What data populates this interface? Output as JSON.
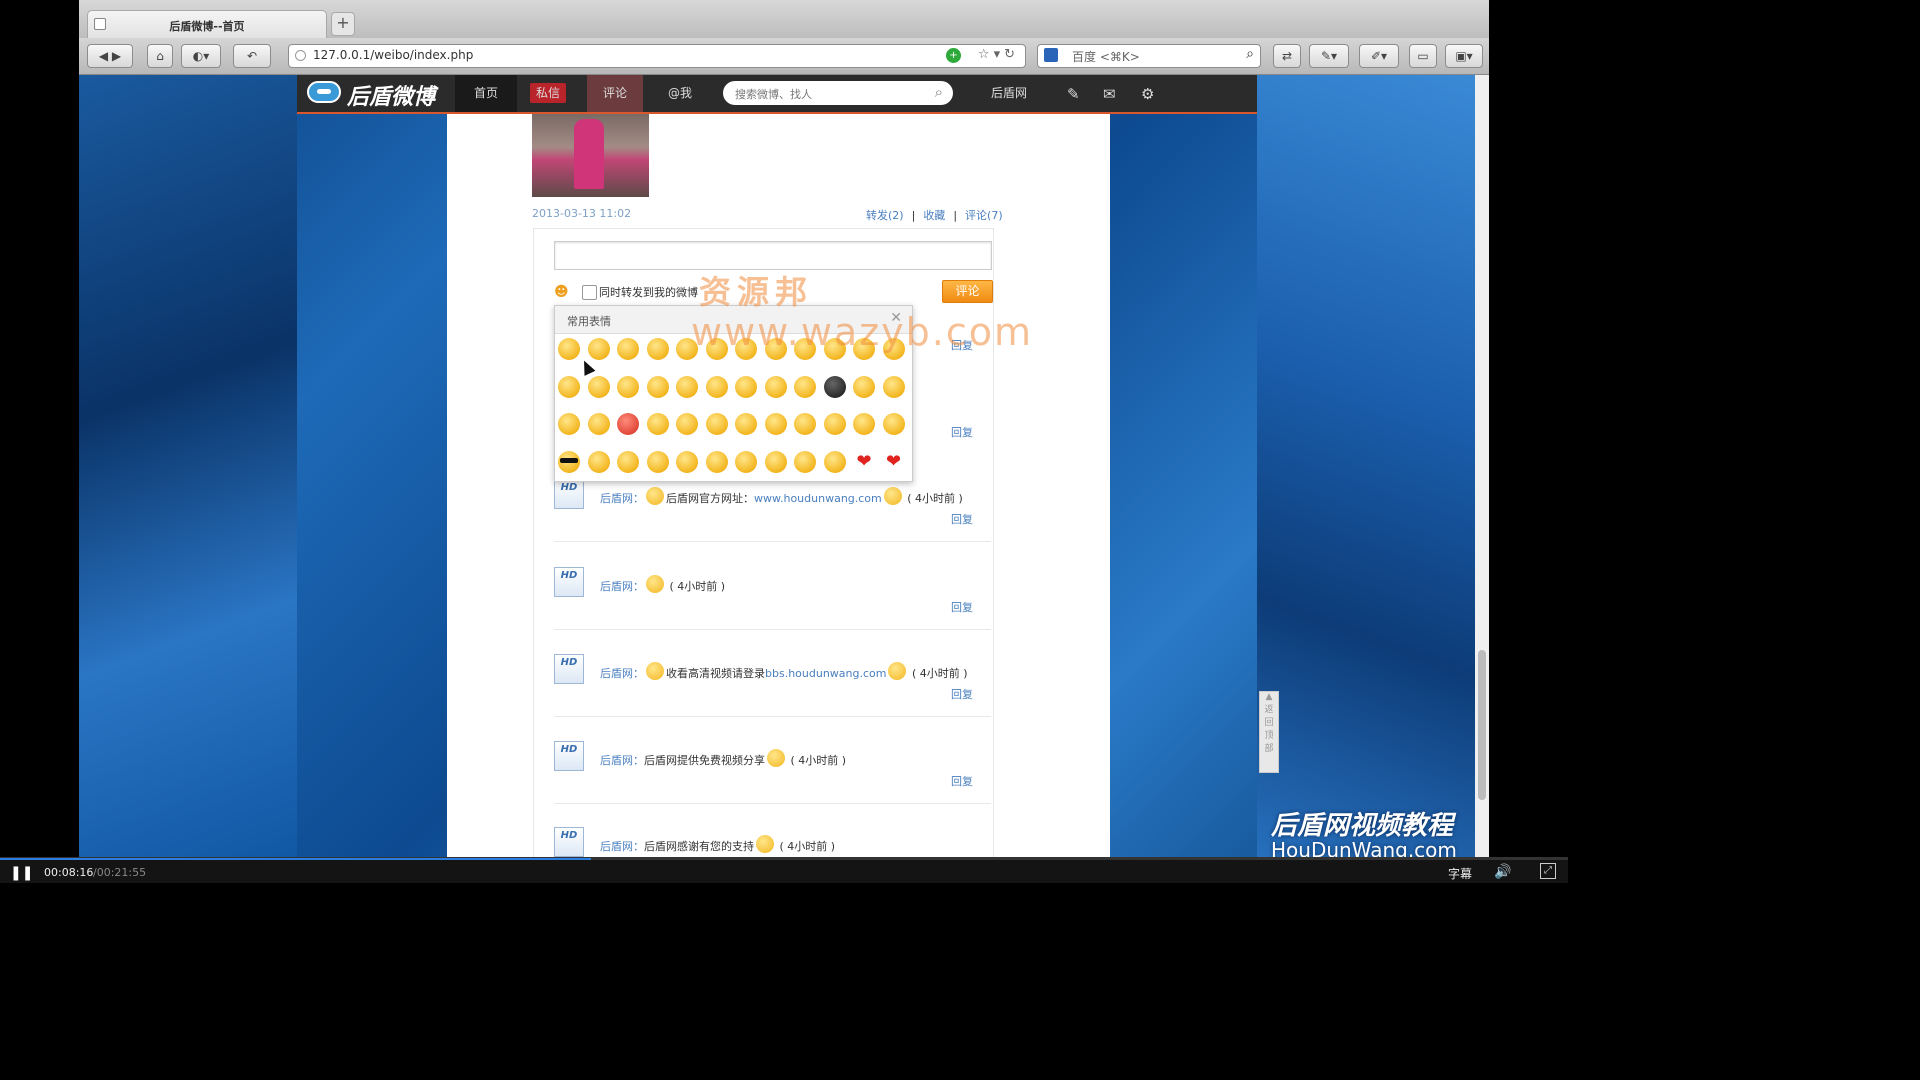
{
  "browser": {
    "tab_title": "后盾微博--首页",
    "new_tab": "+",
    "url": "127.0.0.1/weibo/index.php",
    "search_placeholder": "百度 <⌘K>"
  },
  "site": {
    "logo": "后盾微博",
    "nav": {
      "home": "首页",
      "messages": "私信",
      "comments": "评论",
      "at_me": "@我"
    },
    "search_placeholder": "搜索微博、找人",
    "username": "后盾网"
  },
  "post": {
    "time": "2013-03-13 11:02",
    "repost": "转发(2)",
    "favorite": "收藏",
    "comment": "评论(7)",
    "sep": "|"
  },
  "comment_form": {
    "repost_label": "同时转发到我的微博",
    "submit": "评论"
  },
  "emoji_panel": {
    "title": "常用表情",
    "close": "✕"
  },
  "reply_label": "回复",
  "comments": [
    {
      "name": "后盾网：",
      "text": "后盾网官方网址：",
      "link": "www.houdunwang.com",
      "time": "( 4小时前 )"
    },
    {
      "name": "后盾网：",
      "text": "",
      "link": "",
      "time": "( 4小时前 )"
    },
    {
      "name": "后盾网：",
      "text": "收看高清视频请登录",
      "link": "bbs.houdunwang.com",
      "time": "( 4小时前 )"
    },
    {
      "name": "后盾网：",
      "text": "后盾网提供免费视频分享",
      "link": "",
      "time": "( 4小时前 )"
    },
    {
      "name": "后盾网：",
      "text": "后盾网感谢有您的支持",
      "link": "",
      "time": "( 4小时前 )"
    }
  ],
  "avatar_text": "HD",
  "watermark": {
    "line1": "资源邦",
    "line2": "www.wazyb.com"
  },
  "brand_watermark": {
    "line1": "后盾网视频教程",
    "line2": "HouDunWang.com"
  },
  "player": {
    "current": "00:08:16",
    "total": "/00:21:55",
    "progress": 0.377,
    "subtitle": "字幕"
  },
  "colors": {
    "accent": "#ef8b12",
    "link": "#4a7fbf",
    "nav_bar": "#2b2b2b",
    "nav_border": "#d9572c"
  }
}
